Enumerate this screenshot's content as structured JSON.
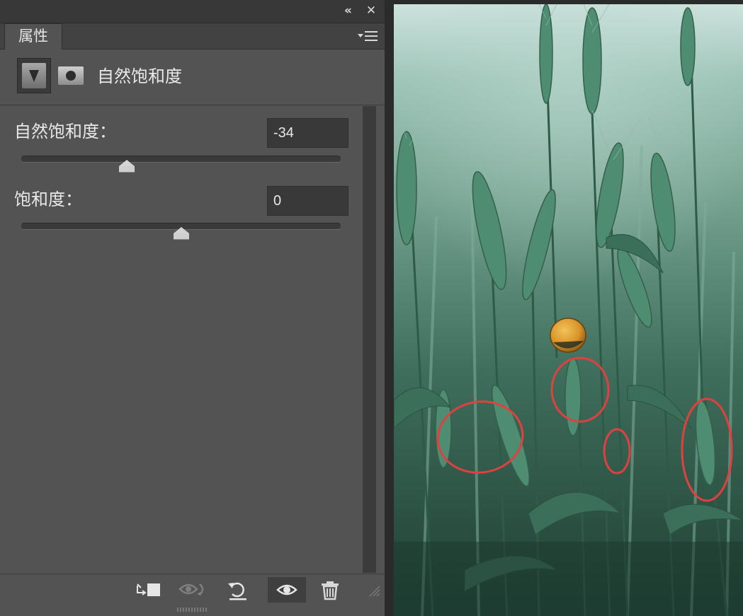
{
  "panel": {
    "tab_label": "属性",
    "header_title": "自然饱和度",
    "vibrance": {
      "label": "自然饱和度：",
      "value": "-34",
      "slider_fraction": 0.33
    },
    "saturation": {
      "label": "饱和度：",
      "value": "0",
      "slider_fraction": 0.5
    }
  },
  "icons": {
    "collapse": "double-chevron-left-icon",
    "close": "close-icon",
    "panel_menu": "panel-menu-icon",
    "adjustment": "vibrance-adjustment-icon",
    "mask": "layer-mask-icon",
    "clip": "clip-to-layer-icon",
    "view_previous": "view-previous-state-icon",
    "reset": "reset-icon",
    "visibility": "eye-icon",
    "delete": "trash-icon"
  },
  "colors": {
    "panel_bg": "#535353",
    "annotation_circle": "#e04040",
    "ladybug": "#d9962a"
  }
}
